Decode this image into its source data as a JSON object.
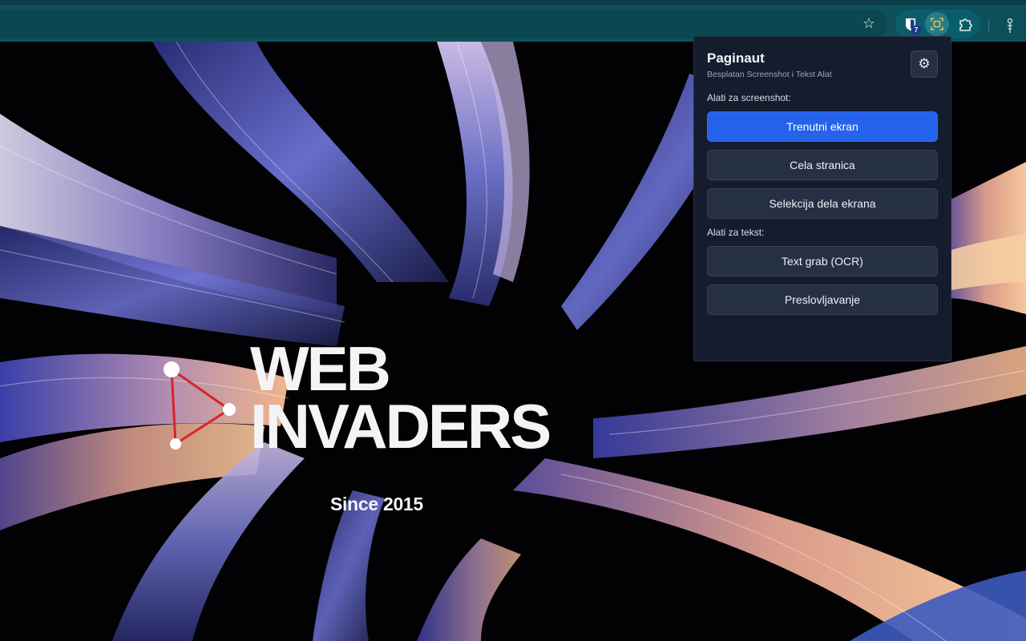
{
  "browser": {
    "extension_badge": "7"
  },
  "hero": {
    "title_line1": "WEB",
    "title_line2": "INVADERS",
    "tagline": "Since 2015"
  },
  "popup": {
    "title": "Paginaut",
    "subtitle": "Besplatan Screenshot i Tekst Alat",
    "screenshot_section": "Alati za screenshot:",
    "text_section": "Alati za tekst:",
    "buttons": {
      "current_screen": "Trenutni ekran",
      "full_page": "Cela stranica",
      "selection": "Selekcija dela ekrana",
      "text_grab": "Text grab (OCR)",
      "transliteration": "Preslovljavanje"
    }
  },
  "colors": {
    "accent": "#2563eb",
    "toolbar": "#0d4f5b",
    "popup_bg": "#141c2e",
    "logo_red": "#d8232a"
  }
}
